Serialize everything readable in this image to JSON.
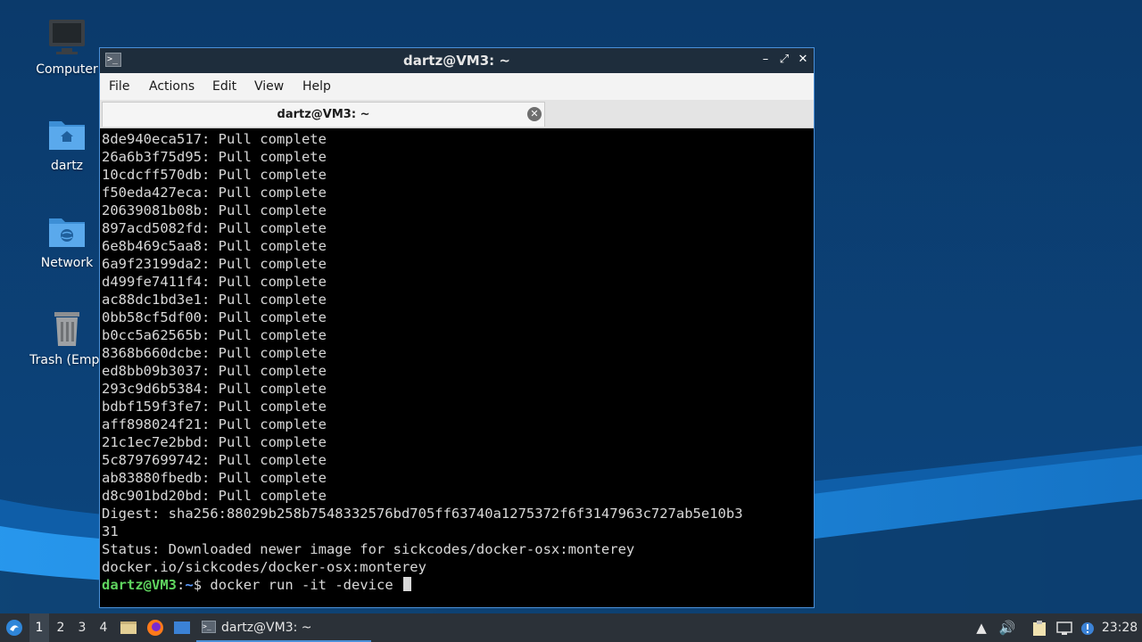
{
  "desktop": {
    "icons": [
      {
        "label": "Computer",
        "icon": "computer-icon"
      },
      {
        "label": "dartz",
        "icon": "home-folder-icon"
      },
      {
        "label": "Network",
        "icon": "network-folder-icon"
      },
      {
        "label": "Trash (Empt",
        "icon": "trash-icon"
      }
    ]
  },
  "window": {
    "title": "dartz@VM3: ~",
    "controls": {
      "minimize": "–",
      "maximize": "⤢",
      "close": "✕"
    },
    "menu": [
      "File",
      "Actions",
      "Edit",
      "View",
      "Help"
    ],
    "tab": {
      "title": "dartz@VM3: ~",
      "close": "✕"
    },
    "terminal": {
      "lines": [
        "8de940eca517: Pull complete",
        "26a6b3f75d95: Pull complete",
        "10cdcff570db: Pull complete",
        "f50eda427eca: Pull complete",
        "20639081b08b: Pull complete",
        "897acd5082fd: Pull complete",
        "6e8b469c5aa8: Pull complete",
        "6a9f23199da2: Pull complete",
        "d499fe7411f4: Pull complete",
        "ac88dc1bd3e1: Pull complete",
        "0bb58cf5df00: Pull complete",
        "b0cc5a62565b: Pull complete",
        "8368b660dcbe: Pull complete",
        "ed8bb09b3037: Pull complete",
        "293c9d6b5384: Pull complete",
        "bdbf159f3fe7: Pull complete",
        "aff898024f21: Pull complete",
        "21c1ec7e2bbd: Pull complete",
        "5c8797699742: Pull complete",
        "ab83880fbedb: Pull complete",
        "d8c901bd20bd: Pull complete",
        "Digest: sha256:88029b258b7548332576bd705ff63740a1275372f6f3147963c727ab5e10b3",
        "31",
        "Status: Downloaded newer image for sickcodes/docker-osx:monterey",
        "docker.io/sickcodes/docker-osx:monterey"
      ],
      "prompt_user": "dartz@VM3",
      "prompt_sep": ":",
      "prompt_path": "~",
      "prompt_symbol": "$",
      "command": " docker run -it -device "
    },
    "colors": {
      "prompt_user": "#5fd45f",
      "prompt_path": "#5c9cff",
      "accent": "#4a90d9"
    }
  },
  "taskbar": {
    "workspaces": [
      "1",
      "2",
      "3",
      "4"
    ],
    "active_workspace": "1",
    "task": {
      "label": "dartz@VM3: ~"
    },
    "clock": "23:28"
  }
}
